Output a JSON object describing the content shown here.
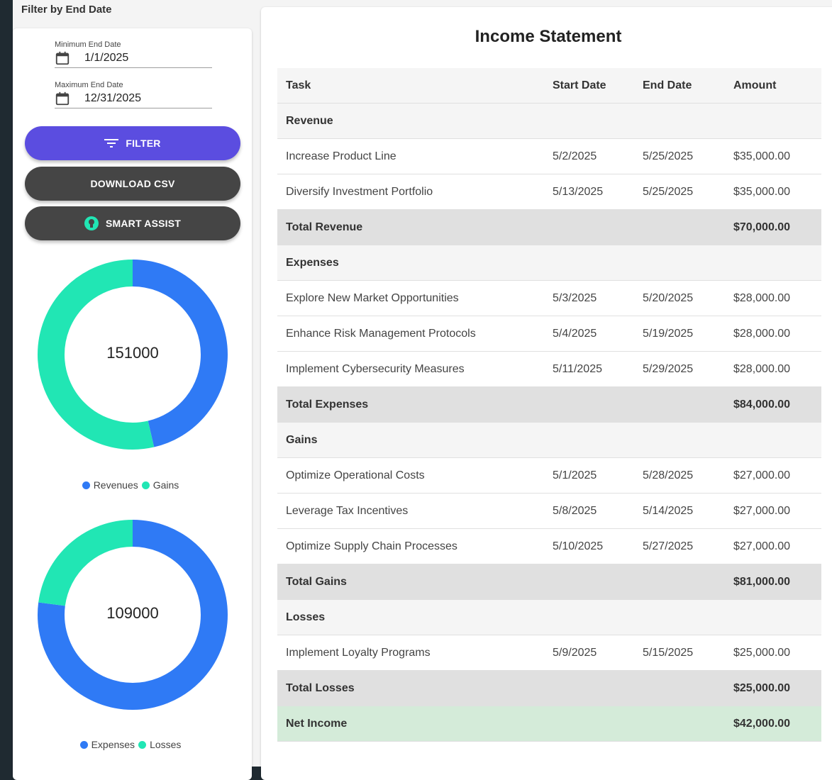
{
  "filter": {
    "heading": "Filter by End Date",
    "min_label": "Minimum End Date",
    "min_value": "1/1/2025",
    "max_label": "Maximum End Date",
    "max_value": "12/31/2025"
  },
  "buttons": {
    "filter": "FILTER",
    "csv": "DOWNLOAD CSV",
    "assist": "SMART ASSIST"
  },
  "colors": {
    "accent": "#5b4de0",
    "dark_button": "#454545",
    "blue": "#2f7af5",
    "teal": "#21e6b4",
    "net_income_bg": "#d4ebd9"
  },
  "icons": {
    "calendar": "calendar-icon",
    "filter": "filter-lines-icon",
    "assist": "lightbulb-icon"
  },
  "charts": {
    "chart1": {
      "center": "151000",
      "legend": [
        "Revenues",
        "Gains"
      ]
    },
    "chart2": {
      "center": "109000",
      "legend": [
        "Expenses",
        "Losses"
      ]
    }
  },
  "chart_data": [
    {
      "type": "pie",
      "categories": [
        "Revenues",
        "Gains"
      ],
      "values": [
        70000,
        81000
      ],
      "colors": [
        "#2f7af5",
        "#21e6b4"
      ]
    },
    {
      "type": "pie",
      "categories": [
        "Expenses",
        "Losses"
      ],
      "values": [
        84000,
        25000
      ],
      "colors": [
        "#2f7af5",
        "#21e6b4"
      ]
    }
  ],
  "statement": {
    "title": "Income Statement",
    "headers": [
      "Task",
      "Start Date",
      "End Date",
      "Amount"
    ],
    "rows": [
      {
        "type": "section",
        "cells": [
          "Revenue",
          "",
          "",
          ""
        ]
      },
      {
        "type": "item",
        "cells": [
          "Increase Product Line",
          "5/2/2025",
          "5/25/2025",
          "$35,000.00"
        ]
      },
      {
        "type": "item",
        "cells": [
          "Diversify Investment Portfolio",
          "5/13/2025",
          "5/25/2025",
          "$35,000.00"
        ]
      },
      {
        "type": "total",
        "cells": [
          "Total Revenue",
          "",
          "",
          "$70,000.00"
        ]
      },
      {
        "type": "section",
        "cells": [
          "Expenses",
          "",
          "",
          ""
        ]
      },
      {
        "type": "item",
        "cells": [
          "Explore New Market Opportunities",
          "5/3/2025",
          "5/20/2025",
          "$28,000.00"
        ]
      },
      {
        "type": "item",
        "cells": [
          "Enhance Risk Management Protocols",
          "5/4/2025",
          "5/19/2025",
          "$28,000.00"
        ]
      },
      {
        "type": "item",
        "cells": [
          "Implement Cybersecurity Measures",
          "5/11/2025",
          "5/29/2025",
          "$28,000.00"
        ]
      },
      {
        "type": "total",
        "cells": [
          "Total Expenses",
          "",
          "",
          "$84,000.00"
        ]
      },
      {
        "type": "section",
        "cells": [
          "Gains",
          "",
          "",
          ""
        ]
      },
      {
        "type": "item",
        "cells": [
          "Optimize Operational Costs",
          "5/1/2025",
          "5/28/2025",
          "$27,000.00"
        ]
      },
      {
        "type": "item",
        "cells": [
          "Leverage Tax Incentives",
          "5/8/2025",
          "5/14/2025",
          "$27,000.00"
        ]
      },
      {
        "type": "item",
        "cells": [
          "Optimize Supply Chain Processes",
          "5/10/2025",
          "5/27/2025",
          "$27,000.00"
        ]
      },
      {
        "type": "total",
        "cells": [
          "Total Gains",
          "",
          "",
          "$81,000.00"
        ]
      },
      {
        "type": "section",
        "cells": [
          "Losses",
          "",
          "",
          ""
        ]
      },
      {
        "type": "item",
        "cells": [
          "Implement Loyalty Programs",
          "5/9/2025",
          "5/15/2025",
          "$25,000.00"
        ]
      },
      {
        "type": "total",
        "cells": [
          "Total Losses",
          "",
          "",
          "$25,000.00"
        ]
      },
      {
        "type": "net",
        "cells": [
          "Net Income",
          "",
          "",
          "$42,000.00"
        ]
      }
    ]
  }
}
